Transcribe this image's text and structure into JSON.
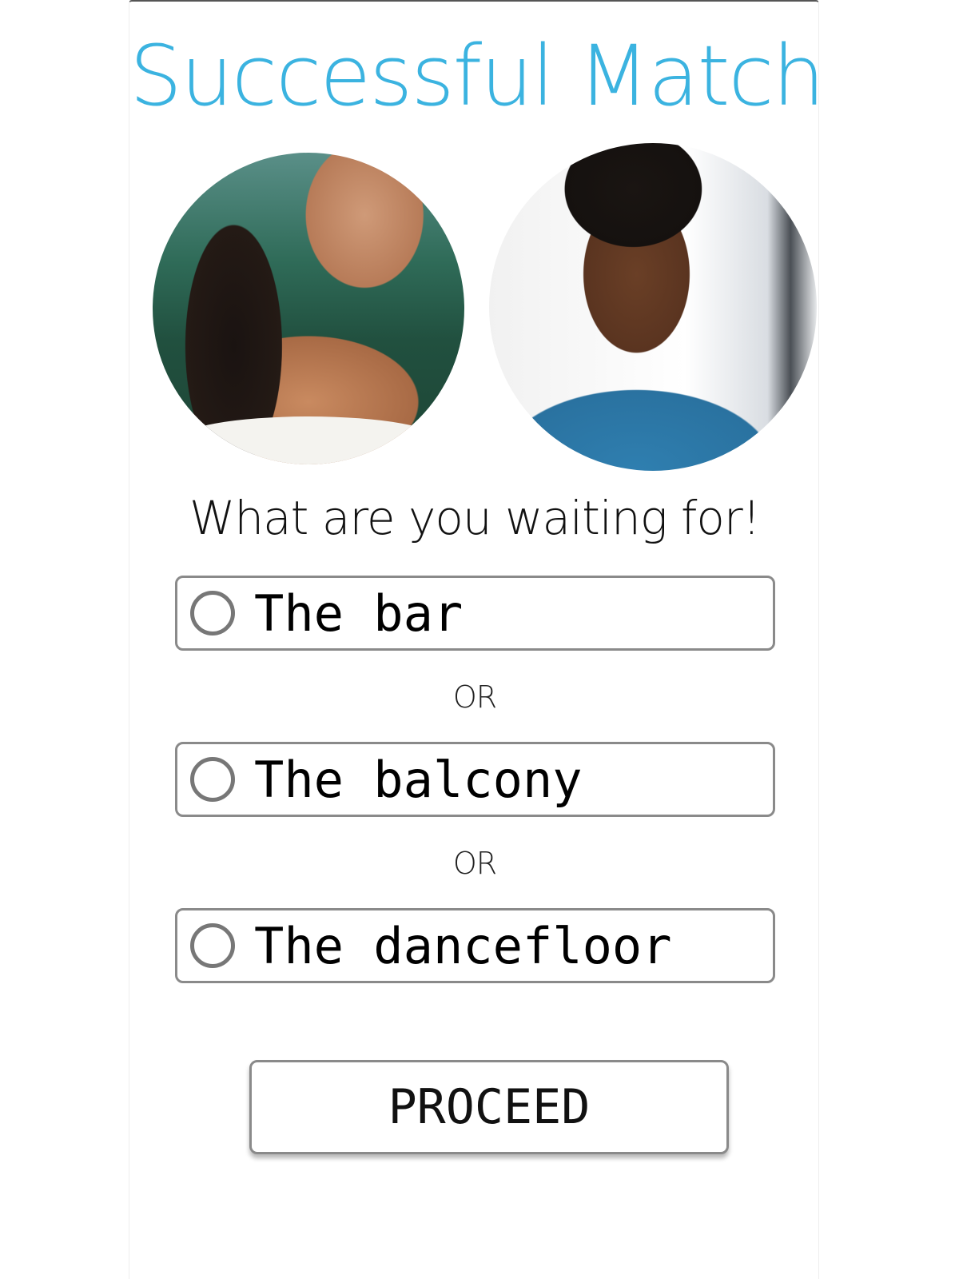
{
  "header": {
    "title": "Successful Match"
  },
  "profiles": {
    "left_avatar": "woman-photo",
    "right_avatar": "man-photo"
  },
  "prompt": "What are you waiting for!",
  "options": [
    {
      "label": "The bar",
      "selected": false
    },
    {
      "label": "The balcony",
      "selected": false
    },
    {
      "label": "The dancefloor",
      "selected": false
    }
  ],
  "separators": [
    "OR",
    "OR"
  ],
  "actions": {
    "proceed_label": "PROCEED"
  },
  "colors": {
    "title": "#3bb3e0",
    "border": "#8a8a8a",
    "text": "#000000"
  }
}
